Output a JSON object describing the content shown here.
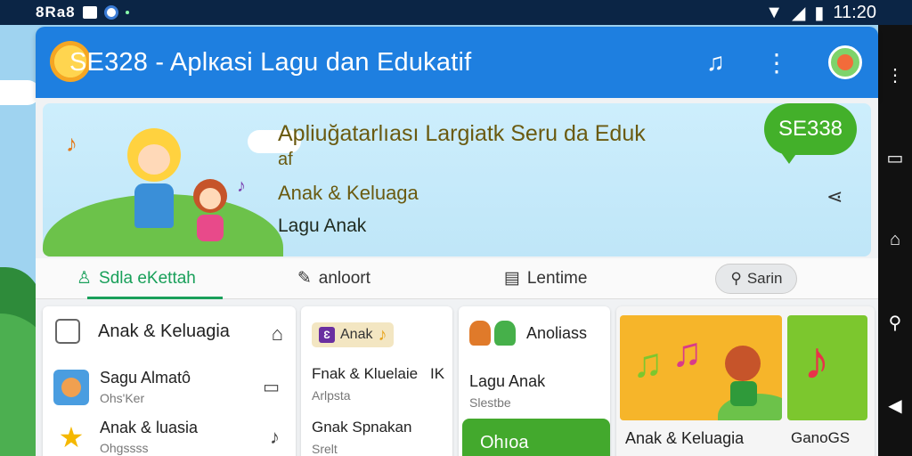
{
  "status_bar": {
    "left_text": "8Ra8",
    "time": "11:20",
    "icons": [
      "notification-icon",
      "app-icon",
      "wifi-icon",
      "signal-icon",
      "battery-icon"
    ]
  },
  "app_bar": {
    "title": "SE328 - Aplкasi Lagu dan Edukatif",
    "icons": [
      "music-note-icon",
      "more-vert-icon",
      "avatar"
    ]
  },
  "hero": {
    "title_line1": "Apliuğatarlıası Largiatk Seru da Eduk",
    "title_line2": "af",
    "subtitle": "Anak & Keluaga",
    "tag": "Lagu Anak",
    "badge": "SE338"
  },
  "tabs": [
    {
      "label": "Sdla eKettah",
      "icon": "person-icon",
      "active": true
    },
    {
      "label": "anloort",
      "icon": "edit-icon",
      "active": false
    },
    {
      "label": "Lentime",
      "icon": "document-icon",
      "active": false
    }
  ],
  "search": {
    "label": "Sarin"
  },
  "card1": {
    "header": "Anak & Keluagia",
    "items": [
      {
        "title": "Sagu Almatô",
        "sub": "Ohs'Ker"
      },
      {
        "title": "Anak & luasia",
        "sub": "Ohgssss"
      }
    ]
  },
  "card2": {
    "chip": "Anak",
    "chip_glyph": "Ɛ",
    "line1": "Fnak & Kluelaie",
    "line1_suffix": "IK",
    "line2": "Arlpsta",
    "line3": "Gnak Spnakan",
    "line4": "Srelt"
  },
  "card3": {
    "header": "Anoliass",
    "line1": "Lagu Anak",
    "line2": "Slestbe",
    "button": "Ohıoa"
  },
  "card4": {
    "caption1": "Anak & Keluagia",
    "caption2": "GanoGS"
  },
  "colors": {
    "app_bar": "#1e7fe0",
    "accent_green": "#19a05a",
    "badge_green": "#43b02a",
    "status_bar": "#0b2545"
  }
}
